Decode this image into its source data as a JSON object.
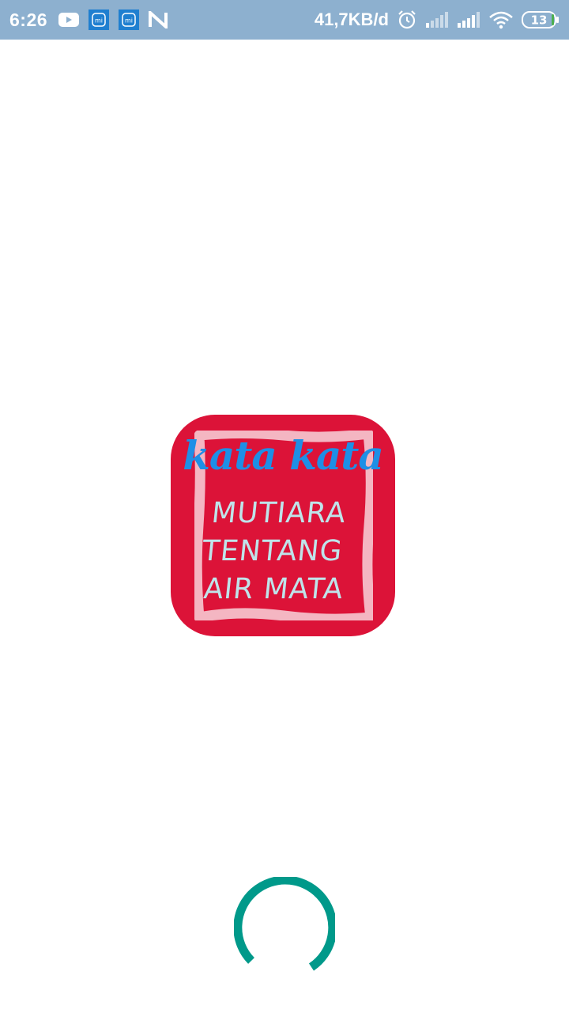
{
  "status_bar": {
    "time": "6:26",
    "network_speed": "41,7KB/d",
    "battery_level": "13",
    "left_icons": [
      "youtube-icon",
      "mi-app-icon",
      "mi-app-icon",
      "n-app-icon"
    ],
    "right_icons": [
      "alarm-icon",
      "signal-icon",
      "signal-icon",
      "wifi-icon",
      "battery-icon"
    ],
    "background_color": "#8db0cf"
  },
  "splash": {
    "logo": {
      "line1": "kata kata",
      "line2": "MUTIARA",
      "line3": "TENTANG",
      "line4": "AIR MATA",
      "background_color": "#dc1338",
      "frame_color": "#f4b6c2",
      "line1_color": "#1e8fe6",
      "text_color": "#bfe4ea"
    },
    "loading_indicator": {
      "color": "#00998a"
    }
  }
}
